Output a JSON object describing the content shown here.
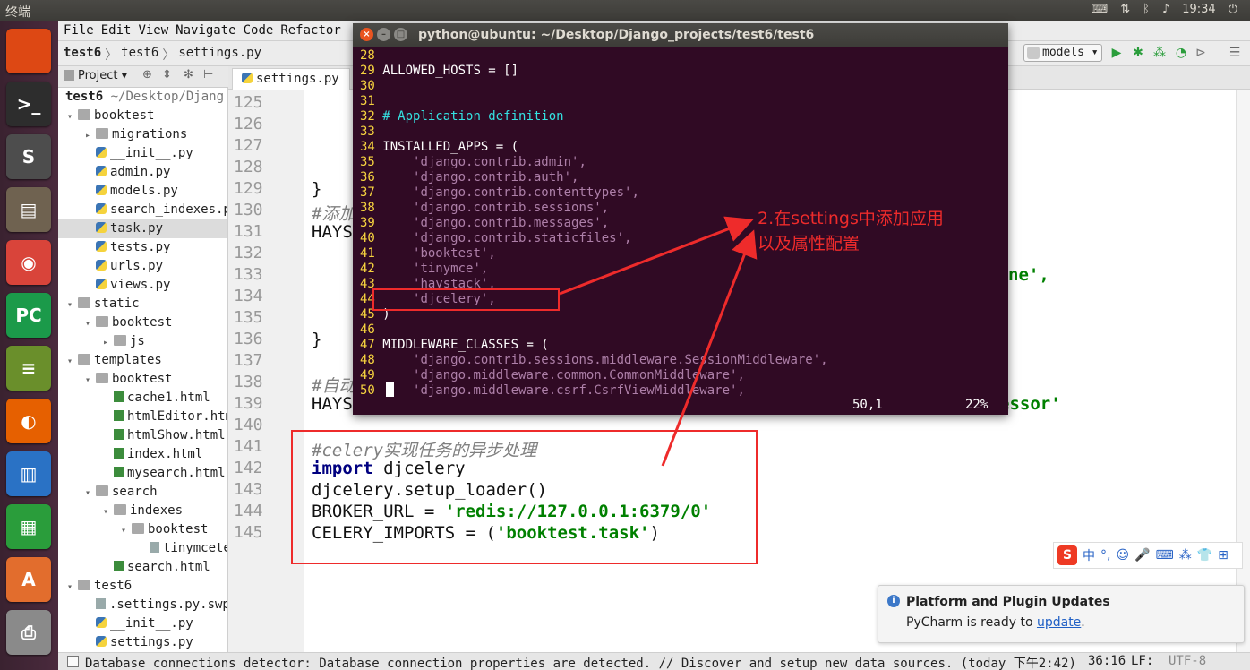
{
  "top_panel": {
    "title": "终端",
    "clock": "19:34",
    "tray_icons": [
      "keyboard-icon",
      "network-icon",
      "bluetooth-icon",
      "volume-icon",
      "power-icon"
    ]
  },
  "launcher": {
    "items": [
      {
        "name": "ubuntu-dash-icon",
        "label": "",
        "color": "#dd4814"
      },
      {
        "name": "terminal-icon",
        "label": ">_",
        "color": "#2d2d2d"
      },
      {
        "name": "sublime-icon",
        "label": "S",
        "color": "#4d4d4d"
      },
      {
        "name": "files-icon",
        "label": "▤",
        "color": "#6f6250"
      },
      {
        "name": "chrome-icon",
        "label": "◉",
        "color": "#d9443a"
      },
      {
        "name": "pycharm-icon",
        "label": "PC",
        "color": "#1b9a4a"
      },
      {
        "name": "books-icon",
        "label": "≡",
        "color": "#6a8f2b"
      },
      {
        "name": "firefox-icon",
        "label": "◐",
        "color": "#e66000"
      },
      {
        "name": "writer-icon",
        "label": "▥",
        "color": "#2a72c5"
      },
      {
        "name": "calc-icon",
        "label": "▦",
        "color": "#2a9d3b"
      },
      {
        "name": "software-center-icon",
        "label": "A",
        "color": "#e26d2d"
      },
      {
        "name": "printer-icon",
        "label": "⎙",
        "color": "#8a8a8a"
      }
    ]
  },
  "menubar": {
    "items": [
      "File",
      "Edit",
      "View",
      "Navigate",
      "Code",
      "Refactor"
    ]
  },
  "navbar": {
    "breadcrumb": [
      "test6",
      "test6",
      "settings.py"
    ],
    "run_config": "models"
  },
  "project_panel": {
    "header": "Project",
    "root": "test6",
    "root_path": "~/Desktop/Djang",
    "rows": [
      {
        "label": "booktest",
        "type": "folder",
        "indent": 0,
        "arrow": "▾"
      },
      {
        "label": "migrations",
        "type": "folder",
        "indent": 1,
        "arrow": "▸"
      },
      {
        "label": "__init__.py",
        "type": "py",
        "indent": 1,
        "arrow": ""
      },
      {
        "label": "admin.py",
        "type": "py",
        "indent": 1,
        "arrow": ""
      },
      {
        "label": "models.py",
        "type": "py",
        "indent": 1,
        "arrow": ""
      },
      {
        "label": "search_indexes.py",
        "type": "py",
        "indent": 1,
        "arrow": ""
      },
      {
        "label": "task.py",
        "type": "py",
        "indent": 1,
        "arrow": "",
        "selected": true
      },
      {
        "label": "tests.py",
        "type": "py",
        "indent": 1,
        "arrow": ""
      },
      {
        "label": "urls.py",
        "type": "py",
        "indent": 1,
        "arrow": ""
      },
      {
        "label": "views.py",
        "type": "py",
        "indent": 1,
        "arrow": ""
      },
      {
        "label": "static",
        "type": "folder",
        "indent": 0,
        "arrow": "▾"
      },
      {
        "label": "booktest",
        "type": "folder",
        "indent": 1,
        "arrow": "▾"
      },
      {
        "label": "js",
        "type": "folder",
        "indent": 2,
        "arrow": "▸"
      },
      {
        "label": "templates",
        "type": "folder",
        "indent": 0,
        "arrow": "▾"
      },
      {
        "label": "booktest",
        "type": "folder",
        "indent": 1,
        "arrow": "▾"
      },
      {
        "label": "cache1.html",
        "type": "html",
        "indent": 2,
        "arrow": ""
      },
      {
        "label": "htmlEditor.html",
        "type": "html",
        "indent": 2,
        "arrow": ""
      },
      {
        "label": "htmlShow.html",
        "type": "html",
        "indent": 2,
        "arrow": ""
      },
      {
        "label": "index.html",
        "type": "html",
        "indent": 2,
        "arrow": ""
      },
      {
        "label": "mysearch.html",
        "type": "html",
        "indent": 2,
        "arrow": ""
      },
      {
        "label": "search",
        "type": "folder",
        "indent": 1,
        "arrow": "▾"
      },
      {
        "label": "indexes",
        "type": "folder",
        "indent": 2,
        "arrow": "▾"
      },
      {
        "label": "booktest",
        "type": "folder",
        "indent": 3,
        "arrow": "▾"
      },
      {
        "label": "tinymcetes",
        "type": "swp",
        "indent": 4,
        "arrow": ""
      },
      {
        "label": "search.html",
        "type": "html",
        "indent": 2,
        "arrow": ""
      },
      {
        "label": "test6",
        "type": "folder",
        "indent": 0,
        "arrow": "▾"
      },
      {
        "label": ".settings.py.swp",
        "type": "swp",
        "indent": 1,
        "arrow": ""
      },
      {
        "label": "__init__.py",
        "type": "py",
        "indent": 1,
        "arrow": ""
      },
      {
        "label": "settings.py",
        "type": "py",
        "indent": 1,
        "arrow": ""
      }
    ]
  },
  "editor": {
    "tab_label": "settings.py",
    "line_numbers": [
      "125",
      "126",
      "127",
      "128",
      "129",
      "130",
      "131",
      "132",
      "133",
      "134",
      "135",
      "136",
      "137",
      "138",
      "139",
      "140",
      "141",
      "142",
      "143",
      "144",
      "145"
    ],
    "fragments": {
      "brace_129": "}",
      "comment_130": "#添加",
      "hays_131": "HAYS",
      "ne_133": "ne',",
      "brace_136": "}",
      "comment_138": "#自动",
      "hays_139": "HAYS",
      "essor_139": "essor'"
    },
    "celery_block": {
      "comment": "#celery实现任务的异步处理",
      "import_kw": "import",
      "import_mod": " djcelery",
      "setup": "djcelery.setup_loader()",
      "broker_lhs": "BROKER_URL = ",
      "broker_val": "'redis://127.0.0.1:6379/0'",
      "imports_lhs": "CELERY_IMPORTS = (",
      "imports_val": "'booktest.task'",
      "imports_rhs": ")"
    }
  },
  "terminal": {
    "title": "python@ubuntu: ~/Desktop/Django_projects/test6/test6",
    "lines": [
      {
        "n": "28",
        "t": "",
        "k": "plain"
      },
      {
        "n": "29",
        "t": "ALLOWED_HOSTS = []",
        "k": "plain"
      },
      {
        "n": "30",
        "t": "",
        "k": "plain"
      },
      {
        "n": "31",
        "t": "",
        "k": "plain"
      },
      {
        "n": "32",
        "t": "# Application definition",
        "k": "comment"
      },
      {
        "n": "33",
        "t": "",
        "k": "plain"
      },
      {
        "n": "34",
        "t": "INSTALLED_APPS = (",
        "k": "plain"
      },
      {
        "n": "35",
        "t": "    'django.contrib.admin',",
        "k": "string"
      },
      {
        "n": "36",
        "t": "    'django.contrib.auth',",
        "k": "string"
      },
      {
        "n": "37",
        "t": "    'django.contrib.contenttypes',",
        "k": "string"
      },
      {
        "n": "38",
        "t": "    'django.contrib.sessions',",
        "k": "string"
      },
      {
        "n": "39",
        "t": "    'django.contrib.messages',",
        "k": "string"
      },
      {
        "n": "40",
        "t": "    'django.contrib.staticfiles',",
        "k": "string"
      },
      {
        "n": "41",
        "t": "    'booktest',",
        "k": "string"
      },
      {
        "n": "42",
        "t": "    'tinymce',",
        "k": "string"
      },
      {
        "n": "43",
        "t": "    'haystack',",
        "k": "string"
      },
      {
        "n": "44",
        "t": "    'djcelery',",
        "k": "string"
      },
      {
        "n": "45",
        "t": ")",
        "k": "plain"
      },
      {
        "n": "46",
        "t": "",
        "k": "plain"
      },
      {
        "n": "47",
        "t": "MIDDLEWARE_CLASSES = (",
        "k": "plain"
      },
      {
        "n": "48",
        "t": "    'django.contrib.sessions.middleware.SessionMiddleware',",
        "k": "string"
      },
      {
        "n": "49",
        "t": "    'django.middleware.common.CommonMiddleware',",
        "k": "string"
      },
      {
        "n": "50",
        "t": "    'django.middleware.csrf.CsrfViewMiddleware',",
        "k": "string"
      }
    ],
    "status_pos": "50,1",
    "status_pct": "22%"
  },
  "annotation": {
    "text_line1": "2.在settings中添加应用",
    "text_line2": "以及属性配置",
    "color": "#ee2b2b"
  },
  "notification": {
    "title": "Platform and Plugin Updates",
    "body_prefix": "PyCharm is ready to ",
    "link": "update",
    "body_suffix": "."
  },
  "ime": {
    "logo": "S",
    "items": [
      "中",
      "°,",
      "☺",
      "🎤",
      "⌨",
      "⁂",
      "👕",
      "⊞"
    ]
  },
  "statusbar": {
    "message": "Database connections detector: Database connection properties are detected. // Discover and setup new data sources. (today 下午2:42)",
    "position": "36:16",
    "line_sep": "LF:",
    "encoding": "UTF-8"
  }
}
